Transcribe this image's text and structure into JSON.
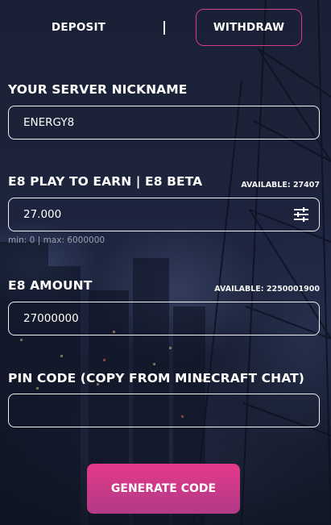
{
  "tabs": {
    "deposit": "DEPOSIT",
    "withdraw": "WITHDRAW"
  },
  "nickname": {
    "label": "YOUR SERVER NICKNAME",
    "value": "ENERGY8"
  },
  "token": {
    "label": "E8 PLAY TO EARN | E8 BETA",
    "available": "AVAILABLE: 27407",
    "value": "27.000",
    "hint": "min: 0 | max: 6000000",
    "icon": "sliders-icon"
  },
  "amount": {
    "label": "E8 AMOUNT",
    "available": "AVAILABLE: 2250001900",
    "value": "27000000"
  },
  "pin": {
    "label": "PIN CODE (COPY FROM MINECRAFT CHAT)",
    "value": ""
  },
  "generate_button": "GENERATE CODE",
  "colors": {
    "accent": "#d83a86",
    "button": "#e6398a",
    "background": "#1c2238"
  }
}
